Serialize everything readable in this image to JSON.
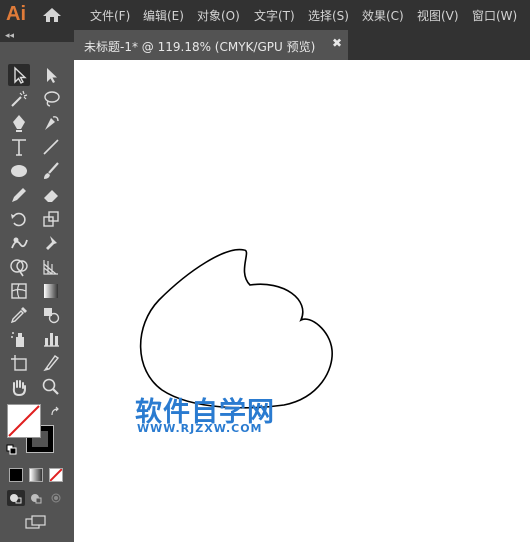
{
  "app": {
    "logo": "Ai"
  },
  "menu": [
    "文件(F)",
    "编辑(E)",
    "对象(O)",
    "文字(T)",
    "选择(S)",
    "效果(C)",
    "视图(V)",
    "窗口(W)"
  ],
  "tab": {
    "title": "未标题-1* @ 119.18% (CMYK/GPU 预览)",
    "close": "✖"
  },
  "panel": {
    "collapse": "◂◂"
  },
  "watermark": {
    "line1": "软件自学网",
    "line2": "WWW.RJZXW.COM"
  },
  "colors": {
    "accent_logo": "#e07b39",
    "watermark": "#2a7bd0",
    "fill": "#ffffff",
    "stroke": "#000000"
  },
  "tools": [
    "selection-tool",
    "direct-selection-tool",
    "magic-wand-tool",
    "lasso-tool",
    "pen-tool",
    "curvature-tool",
    "type-tool",
    "line-segment-tool",
    "ellipse-tool",
    "paintbrush-tool",
    "pencil-tool",
    "eraser-tool",
    "rotate-tool",
    "scale-tool",
    "warp-tool",
    "puppet-warp-tool",
    "shape-builder-tool",
    "perspective-grid-tool",
    "mesh-tool",
    "gradient-tool",
    "eyedropper-tool",
    "blend-tool",
    "symbol-sprayer-tool",
    "column-graph-tool",
    "artboard-tool",
    "slice-tool",
    "hand-tool",
    "zoom-tool"
  ]
}
